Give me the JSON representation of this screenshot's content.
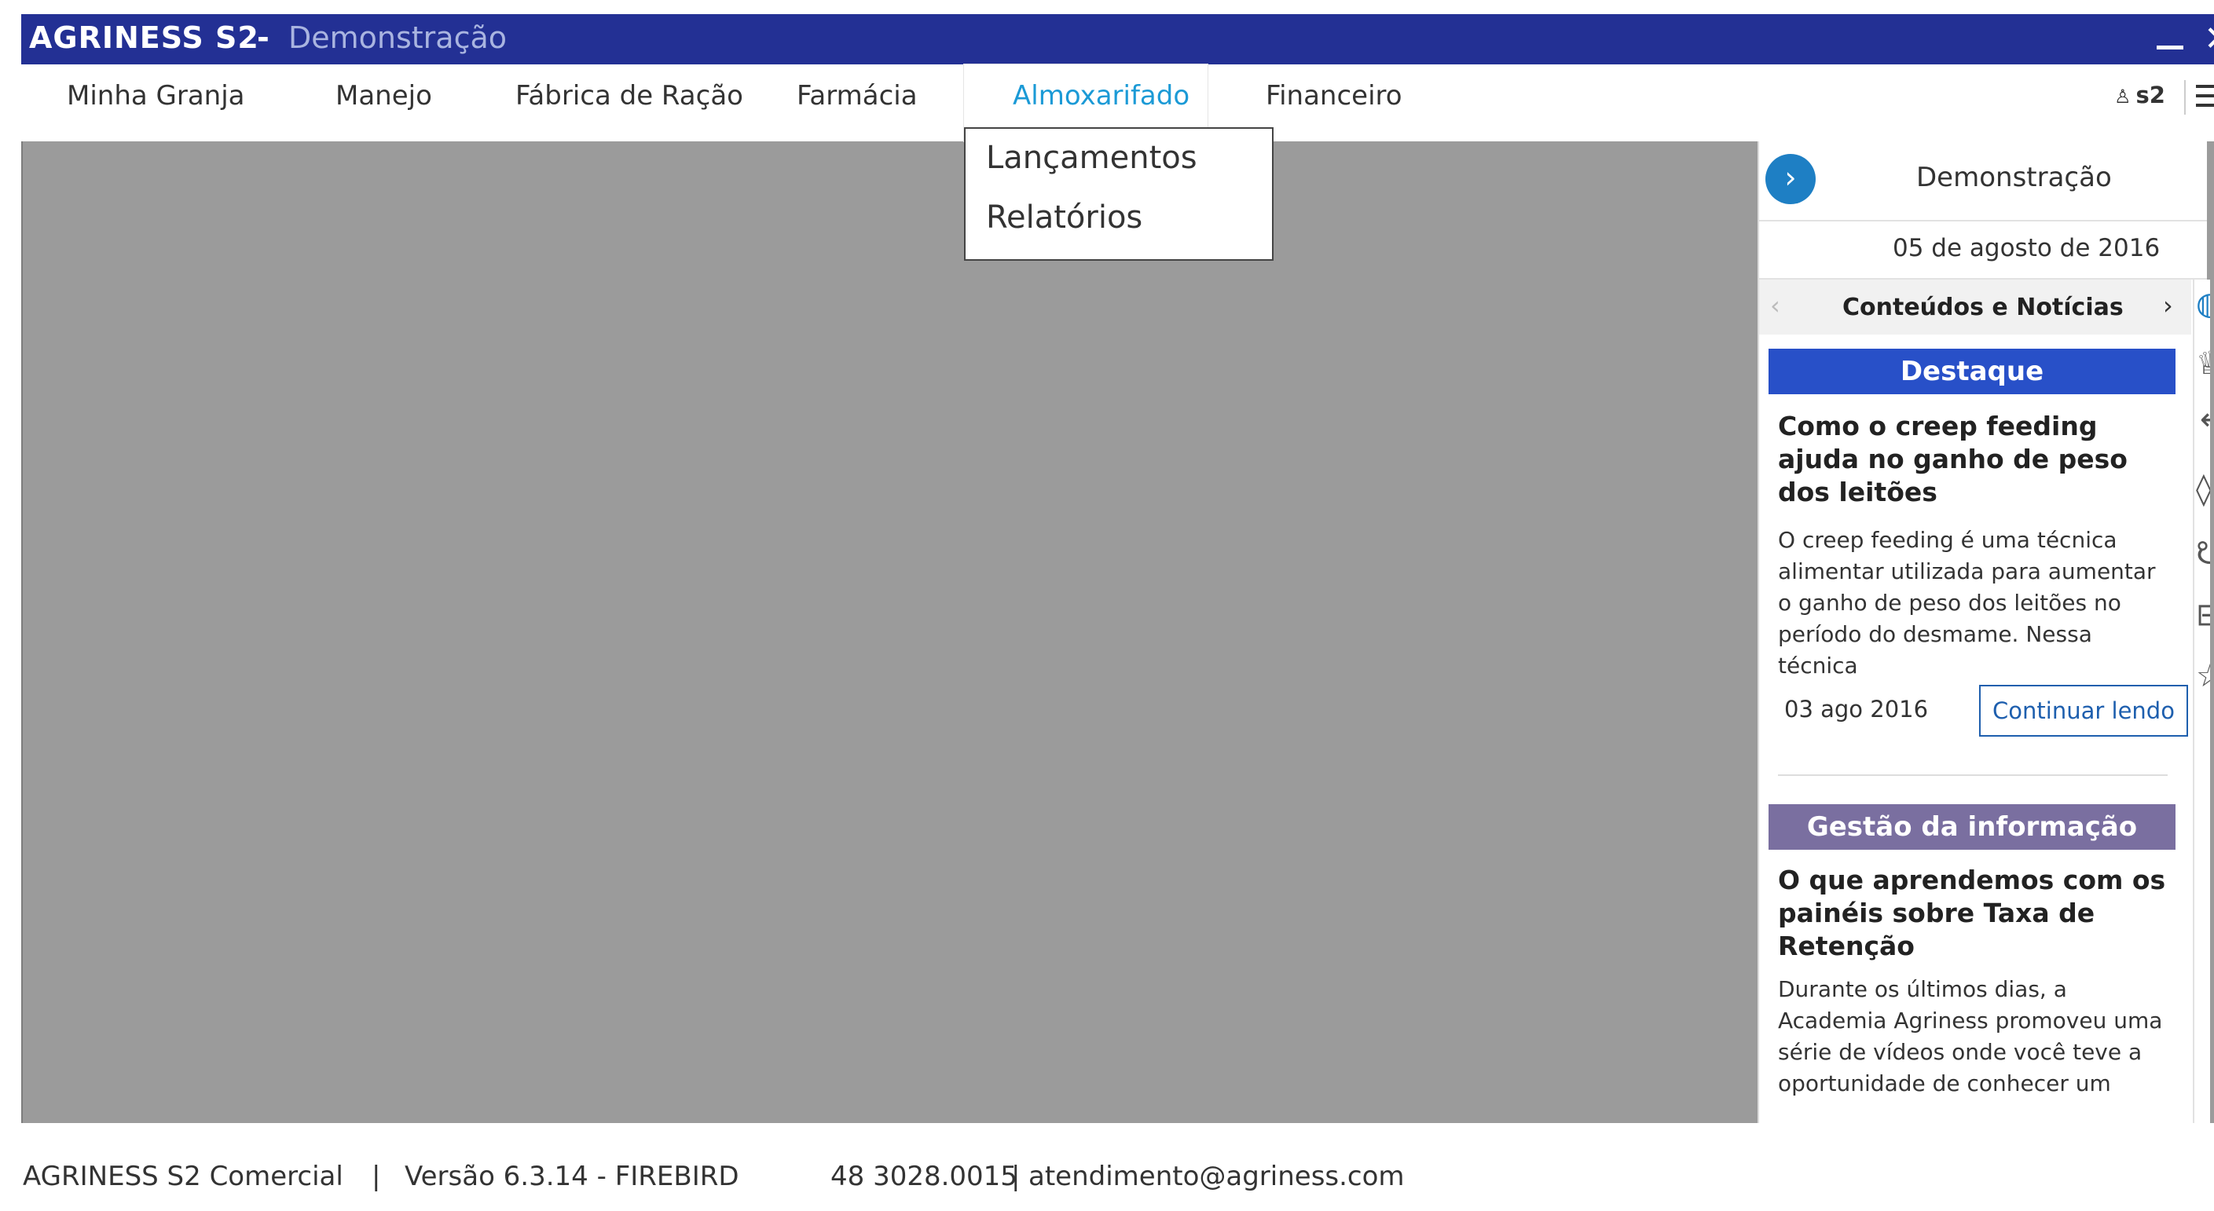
{
  "titlebar": {
    "brand": "AGRINESS S2",
    "separator": "-",
    "subtitle": "Demonstração"
  },
  "menu": {
    "items": [
      {
        "label": "Minha Granja"
      },
      {
        "label": "Manejo"
      },
      {
        "label": "Fábrica de Ração"
      },
      {
        "label": "Farmácia"
      },
      {
        "label": "Almoxarifado"
      },
      {
        "label": "Financeiro"
      }
    ],
    "active_index": 4,
    "user": "s2"
  },
  "dropdown": {
    "items": [
      {
        "label": "Lançamentos"
      },
      {
        "label": "Relatórios"
      }
    ]
  },
  "right_panel": {
    "title": "Demonstração",
    "date": "05 de agosto de 2016",
    "section_label": "Conteúdos e Notícias",
    "news": [
      {
        "category": "Destaque",
        "category_color": "#2850c8",
        "title": "Como o creep feeding ajuda no ganho de peso dos leitões",
        "body": "O creep feeding é uma técnica alimentar utilizada para aumentar o ganho de peso dos leitões no período do desmame. Nessa técnica",
        "date": "03 ago 2016",
        "action": "Continuar lendo"
      },
      {
        "category": "Gestão da informação",
        "category_color": "#7a6fa0",
        "title": "O que aprendemos com os painéis sobre Taxa de Retenção",
        "body": "Durante os últimos dias, a Academia Agriness promoveu uma série de vídeos onde você teve a oportunidade de conhecer um"
      }
    ],
    "strip_icons": [
      "globe-icon",
      "trophy-icon",
      "hook-icon",
      "bottle-icon",
      "pig-icon",
      "inbox-icon",
      "star-icon"
    ]
  },
  "footer": {
    "product": "AGRINESS S2 Comercial",
    "divider": "|",
    "version": "Versão 6.3.14 - FIREBIRD",
    "phone": "48 3028.0015",
    "email": "atendimento@agriness.com"
  },
  "colors": {
    "titlebar": "#233094",
    "workspace": "#9b9b9b",
    "accent": "#1b9ad6",
    "highlight": "#2850c8",
    "info": "#7a6fa0"
  }
}
